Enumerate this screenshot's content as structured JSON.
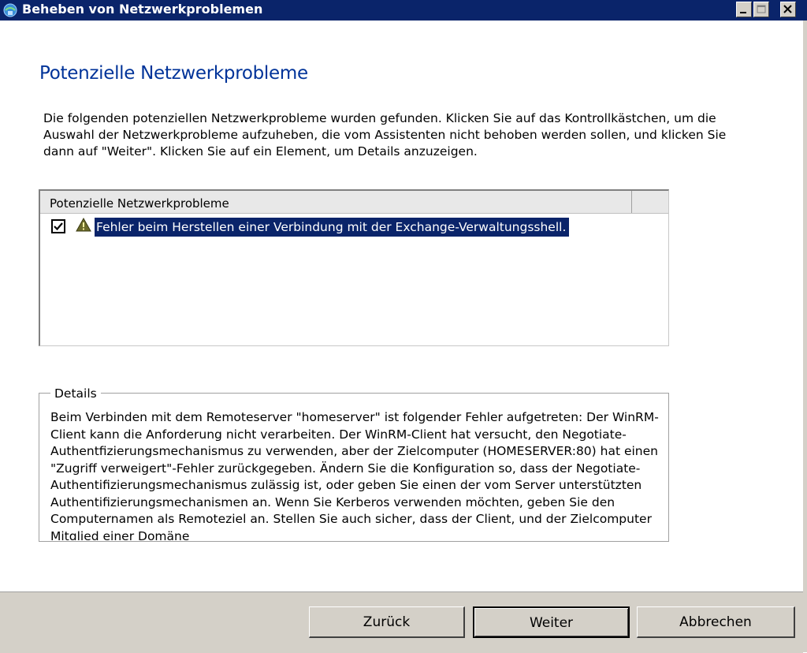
{
  "window": {
    "title": "Beheben von Netzwerkproblemen",
    "accent": "#0a246a"
  },
  "main": {
    "heading": "Potenzielle Netzwerkprobleme",
    "intro": "Die folgenden potenziellen Netzwerkprobleme wurden gefunden. Klicken Sie auf das Kontrollkästchen, um die Auswahl der Netzwerkprobleme aufzuheben, die vom Assistenten nicht behoben werden sollen, und klicken Sie dann auf \"Weiter\". Klicken Sie auf ein Element, um Details anzuzeigen."
  },
  "list": {
    "header": "Potenzielle Netzwerkprobleme",
    "items": [
      {
        "checked": true,
        "icon": "warning-icon",
        "label": "Fehler beim Herstellen einer Verbindung mit der Exchange-Verwaltungsshell."
      }
    ]
  },
  "details": {
    "legend": "Details",
    "text": "Beim Verbinden mit dem Remoteserver \"homeserver\" ist folgender Fehler aufgetreten: Der WinRM-Client kann die Anforderung nicht verarbeiten. Der WinRM-Client hat versucht, den Negotiate-Authentfizierungsmechanismus zu verwenden, aber der Zielcomputer (HOMESERVER:80) hat einen \"Zugriff verweigert\"-Fehler zurückgegeben. Ändern Sie die Konfiguration so, dass der Negotiate-Authentifizierungsmechanismus zulässig ist, oder geben Sie einen der vom Server unterstützten Authentifizierungsmechanismen an. Wenn Sie Kerberos verwenden möchten, geben Sie den Computernamen als Remoteziel an. Stellen Sie auch sicher, dass der Client, und der Zielcomputer Mitglied einer Domäne"
  },
  "buttons": {
    "back": "Zurück",
    "next": "Weiter",
    "cancel": "Abbrechen"
  }
}
